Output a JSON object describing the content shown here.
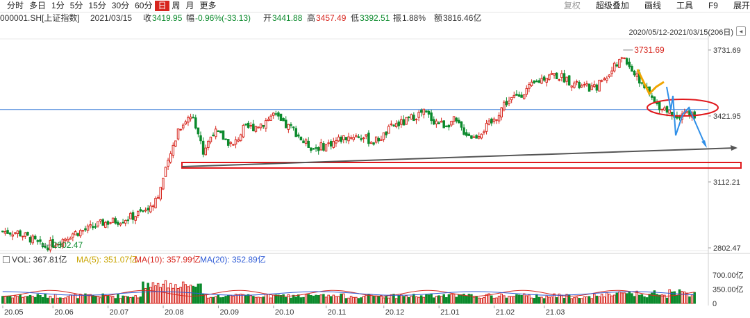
{
  "toolbar": {
    "periods": [
      "分时",
      "多日",
      "1分",
      "5分",
      "15分",
      "30分",
      "60分",
      "日",
      "周",
      "月",
      "更多"
    ],
    "active_period": "日",
    "right_items": [
      "复权",
      "超级叠加",
      "画线",
      "工具",
      "F9",
      "展开"
    ]
  },
  "info": {
    "code": "000001.SH[上证指数]",
    "date": "2021/03/15",
    "close_label": "收",
    "close": "3419.95",
    "change_label": "幅",
    "change": "-0.96%(-33.13)",
    "open_label": "开",
    "open": "3441.88",
    "high_label": "高",
    "high": "3457.49",
    "low_label": "低",
    "low": "3392.51",
    "amplitude_label": "振",
    "amplitude": "1.88%",
    "amount_label": "额",
    "amount": "3816.46亿"
  },
  "range_text": "2020/05/12-2021/03/15(206日)",
  "volume_bar": {
    "vol": "VOL: 367.81亿",
    "ma5": "MA(5): 351.07亿",
    "ma10": "MA(10): 357.99亿",
    "ma20": "MA(20): 352.89亿"
  },
  "colors": {
    "up": "#d7261e",
    "down": "#0b8a2c",
    "grid": "#e8e8e8",
    "hline": "#3a7ed8",
    "trend": "#555555",
    "box": "#e0191d",
    "yellow_arrow": "#f0a500",
    "blue_arrow": "#2f8fe8",
    "ma5": "#c9a400",
    "ma10": "#d7261e",
    "ma20": "#2e5bd6"
  },
  "chart_data": {
    "type": "candlestick",
    "price_axis": {
      "ticks": [
        3731.69,
        3421.95,
        3112.21,
        2802.47
      ],
      "ylim": [
        2802.47,
        3731.69
      ]
    },
    "volume_axis": {
      "ticks": [
        "700.00亿",
        "350.00亿",
        "0"
      ],
      "ylim": [
        0,
        700
      ]
    },
    "x_labels": [
      "20.05",
      "20.06",
      "20.07",
      "20.08",
      "20.09",
      "20.10",
      "20.11",
      "20.12",
      "21.01",
      "21.02",
      "21.03"
    ],
    "annotations": {
      "max": "3731.69",
      "min": "2802.47"
    },
    "reference_line": 3452.0,
    "price_points": [
      [
        0,
        2880
      ],
      [
        6,
        2875
      ],
      [
        12,
        2840
      ],
      [
        16,
        2805
      ],
      [
        22,
        2830
      ],
      [
        28,
        2870
      ],
      [
        34,
        2890
      ],
      [
        40,
        2920
      ],
      [
        46,
        2930
      ],
      [
        52,
        2950
      ],
      [
        58,
        2985
      ],
      [
        62,
        3050
      ],
      [
        66,
        3200
      ],
      [
        70,
        3360
      ],
      [
        73,
        3400
      ],
      [
        76,
        3430
      ],
      [
        80,
        3250
      ],
      [
        84,
        3350
      ],
      [
        88,
        3320
      ],
      [
        92,
        3280
      ],
      [
        96,
        3360
      ],
      [
        100,
        3370
      ],
      [
        104,
        3390
      ],
      [
        108,
        3430
      ],
      [
        112,
        3380
      ],
      [
        116,
        3360
      ],
      [
        120,
        3300
      ],
      [
        124,
        3270
      ],
      [
        128,
        3280
      ],
      [
        132,
        3300
      ],
      [
        136,
        3320
      ],
      [
        140,
        3330
      ],
      [
        144,
        3320
      ],
      [
        148,
        3300
      ],
      [
        152,
        3330
      ],
      [
        156,
        3380
      ],
      [
        160,
        3390
      ],
      [
        164,
        3420
      ],
      [
        168,
        3440
      ],
      [
        172,
        3400
      ],
      [
        176,
        3380
      ],
      [
        180,
        3400
      ],
      [
        184,
        3350
      ],
      [
        188,
        3320
      ],
      [
        192,
        3360
      ],
      [
        196,
        3400
      ],
      [
        200,
        3480
      ],
      [
        206,
        3520
      ],
      [
        212,
        3570
      ],
      [
        218,
        3620
      ],
      [
        224,
        3600
      ],
      [
        230,
        3560
      ],
      [
        236,
        3550
      ],
      [
        240,
        3600
      ],
      [
        244,
        3650
      ],
      [
        248,
        3700
      ],
      [
        252,
        3620
      ],
      [
        256,
        3560
      ],
      [
        260,
        3480
      ],
      [
        264,
        3460
      ],
      [
        268,
        3420
      ],
      [
        272,
        3440
      ],
      [
        276,
        3420
      ]
    ]
  }
}
